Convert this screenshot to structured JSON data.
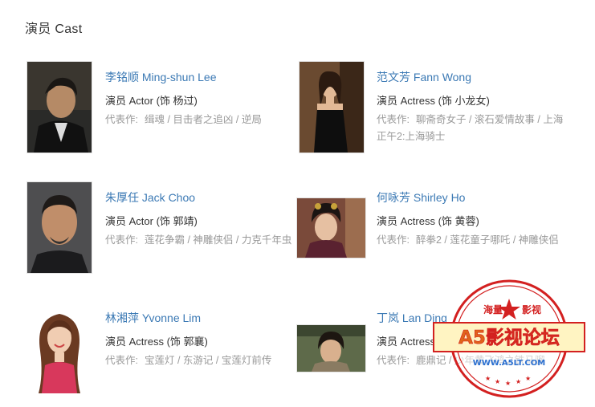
{
  "section": {
    "title": "演员 Cast"
  },
  "works_label": "代表作:",
  "cast": [
    {
      "name": "李铭顺 Ming-shun Lee",
      "role": "演员 Actor (饰 杨过)",
      "works": "缉魂 / 目击者之追凶 / 逆局"
    },
    {
      "name": "范文芳 Fann Wong",
      "role": "演员 Actress (饰 小龙女)",
      "works": "聊斋奇女子 / 滚石爱情故事 / 上海正午2:上海骑士"
    },
    {
      "name": "朱厚任 Jack Choo",
      "role": "演员 Actor (饰 郭靖)",
      "works": "莲花争霸 / 神雕侠侣 / 力克千年虫"
    },
    {
      "name": "何咏芳 Shirley Ho",
      "role": "演员 Actress (饰 黄蓉)",
      "works": "醉拳2 / 莲花童子哪吒 / 神雕侠侣"
    },
    {
      "name": "林湘萍 Yvonne Lim",
      "role": "演员 Actress (饰 郭襄)",
      "works": "宝莲灯 / 东游记 / 宝莲灯前传"
    },
    {
      "name": "丁岚 Lan Ding",
      "role": "演员 Actress (饰 李莫愁)",
      "works": "鹿鼎记 / 少年黄飞鸿之铁马骝"
    }
  ],
  "watermark": {
    "top_left": "海量",
    "top_right": "影视",
    "banner": "A5影视论坛",
    "url": "WWW.A5LT.COM",
    "color": "#d32020"
  }
}
